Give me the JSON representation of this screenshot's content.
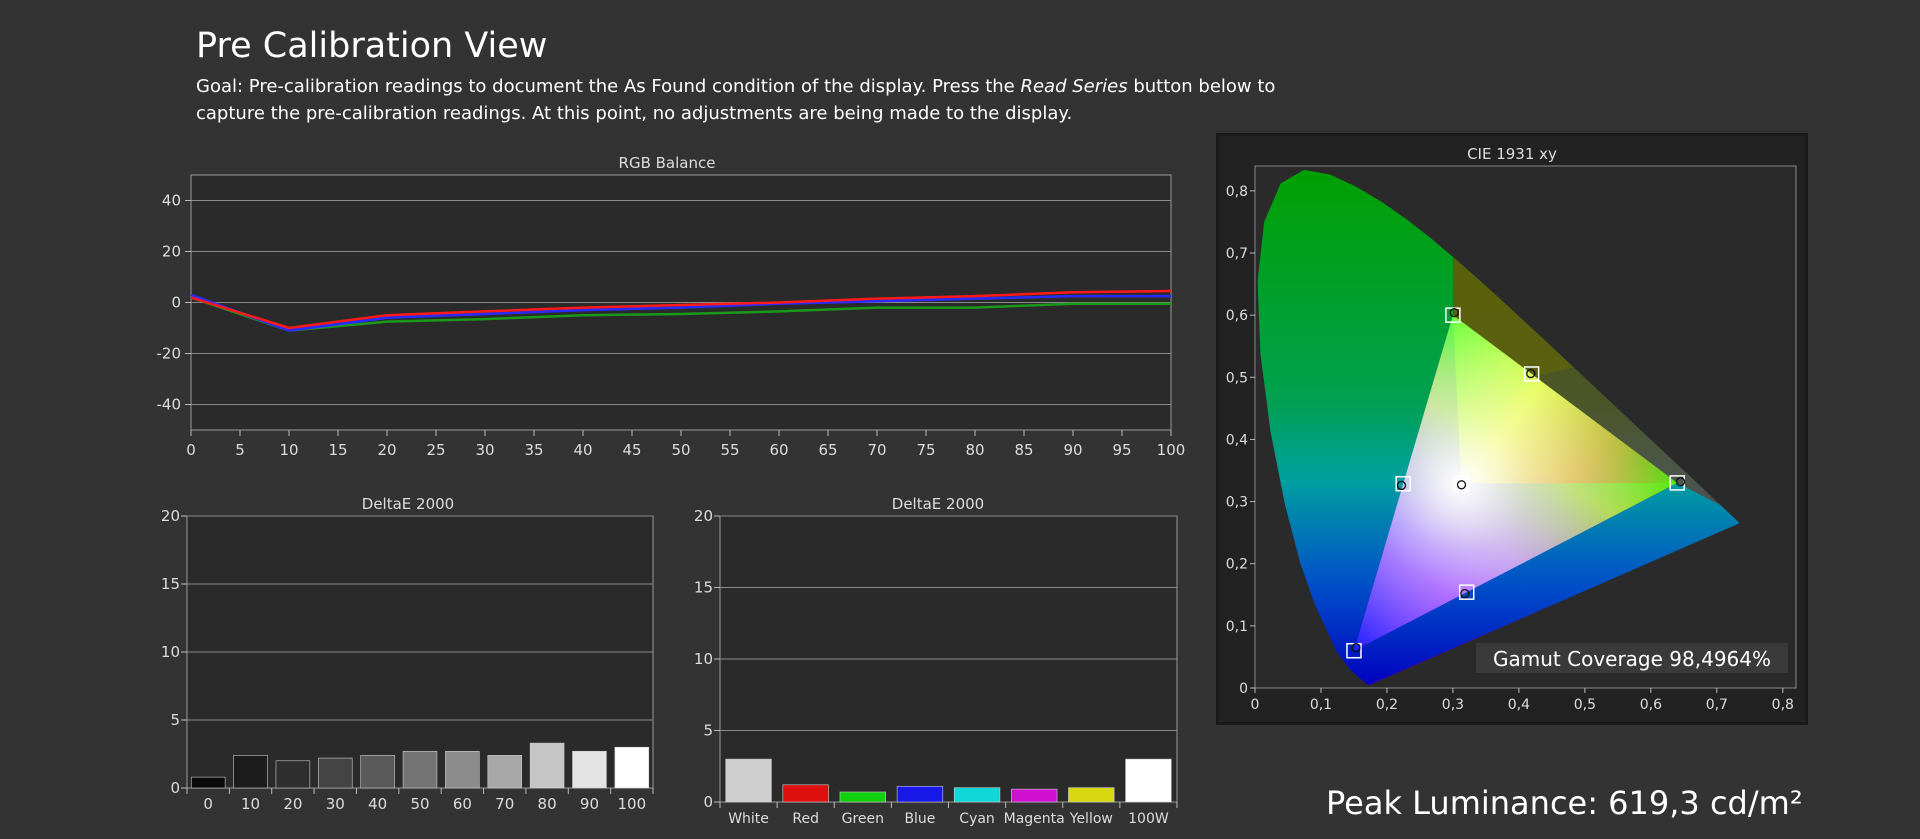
{
  "header": {
    "title": "Pre Calibration View",
    "goal_before": "Goal: Pre-calibration readings to document the As Found condition of the display. Press the ",
    "goal_italic": "Read Series",
    "goal_after": " button below to capture the pre-calibration readings. At this point, no adjustments are being made to the display."
  },
  "peak_luminance": "Peak Luminance: 619,3 cd/m²",
  "chart_data": [
    {
      "id": "rgb-balance",
      "type": "line",
      "title": "RGB Balance",
      "x": [
        0,
        10,
        20,
        30,
        40,
        50,
        60,
        70,
        80,
        90,
        100
      ],
      "xticks": [
        "0",
        "5",
        "10",
        "15",
        "20",
        "25",
        "30",
        "35",
        "40",
        "45",
        "50",
        "55",
        "60",
        "65",
        "70",
        "75",
        "80",
        "85",
        "90",
        "95",
        "100"
      ],
      "yticks": [
        "40",
        "20",
        "0",
        "-20",
        "-40"
      ],
      "xlim": [
        0,
        100
      ],
      "ylim": [
        -50,
        50
      ],
      "grid": true,
      "series": [
        {
          "color": "#ff1a1a",
          "values": [
            2,
            -10,
            -5,
            -3.5,
            -2,
            -1,
            0,
            1.5,
            2.5,
            4,
            4.5
          ]
        },
        {
          "color": "#2a2aff",
          "values": [
            3,
            -11,
            -6,
            -4.5,
            -3,
            -2,
            -0.5,
            0.5,
            1.5,
            2.5,
            2.5
          ]
        },
        {
          "color": "#1a9a1a",
          "values": [
            2,
            -11,
            -7.5,
            -6.5,
            -5,
            -4.5,
            -3.5,
            -2,
            -2,
            -0.5,
            -0.5
          ]
        }
      ]
    },
    {
      "id": "deltae-gray",
      "type": "bar",
      "title": "DeltaE 2000",
      "categories": [
        "0",
        "10",
        "20",
        "30",
        "40",
        "50",
        "60",
        "70",
        "80",
        "90",
        "100"
      ],
      "values": [
        0.8,
        2.4,
        2.0,
        2.2,
        2.4,
        2.7,
        2.7,
        2.4,
        3.3,
        2.7,
        3.0
      ],
      "colors": [
        "#0a0a0a",
        "#1c1c1c",
        "#2e2e2e",
        "#444444",
        "#5a5a5a",
        "#737373",
        "#8c8c8c",
        "#a8a8a8",
        "#c6c6c6",
        "#e4e4e4",
        "#ffffff"
      ],
      "yticks": [
        "0",
        "5",
        "10",
        "15",
        "20"
      ],
      "ylim": [
        0,
        20
      ],
      "grid": true
    },
    {
      "id": "deltae-color",
      "type": "bar",
      "title": "DeltaE 2000",
      "categories": [
        "White",
        "Red",
        "Green",
        "Blue",
        "Cyan",
        "Magenta",
        "Yellow",
        "100W"
      ],
      "values": [
        3.0,
        1.2,
        0.7,
        1.1,
        1.0,
        0.9,
        1.0,
        3.0
      ],
      "colors": [
        "#cfcfcf",
        "#e01010",
        "#10d010",
        "#1818e8",
        "#10d8d8",
        "#d010d0",
        "#d8d810",
        "#ffffff"
      ],
      "yticks": [
        "0",
        "5",
        "10",
        "15",
        "20"
      ],
      "ylim": [
        0,
        20
      ],
      "grid": true
    },
    {
      "id": "cie",
      "type": "scatter",
      "title": "CIE 1931 xy",
      "xticks": [
        "0",
        "0,1",
        "0,2",
        "0,3",
        "0,4",
        "0,5",
        "0,6",
        "0,7",
        "0,8"
      ],
      "yticks": [
        "0,8",
        "0,7",
        "0,6",
        "0,5",
        "0,4",
        "0,3",
        "0,2",
        "0,1",
        "0"
      ],
      "xlim": [
        0,
        0.82
      ],
      "ylim": [
        0,
        0.84
      ],
      "gamut_label": "Gamut Coverage 98,4964%",
      "targets": [
        [
          0.64,
          0.33
        ],
        [
          0.3,
          0.6
        ],
        [
          0.15,
          0.06
        ],
        [
          0.4193,
          0.5053
        ],
        [
          0.2246,
          0.3287
        ],
        [
          0.3209,
          0.1542
        ],
        [
          0.3127,
          0.329
        ]
      ],
      "measured": [
        [
          0.645,
          0.332
        ],
        [
          0.302,
          0.604
        ],
        [
          0.153,
          0.065
        ],
        [
          0.418,
          0.506
        ],
        [
          0.222,
          0.326
        ],
        [
          0.318,
          0.152
        ],
        [
          0.313,
          0.327
        ]
      ]
    }
  ]
}
